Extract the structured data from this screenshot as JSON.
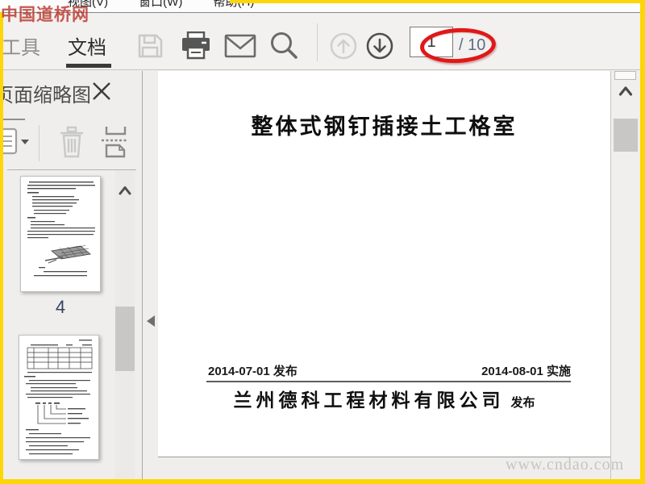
{
  "stamp_watermark": "中国道桥网",
  "site_watermark": "www.cndao.com",
  "menu_bar": {
    "items": [
      {
        "label": "视图(V)"
      },
      {
        "label": "窗口(W)"
      },
      {
        "label": "帮助(H)"
      }
    ]
  },
  "toolbar": {
    "tools_tab": "工具",
    "document_tab": "文档",
    "page_input": {
      "value": "1"
    },
    "page_total": "/ 10"
  },
  "sidebar": {
    "title": "页面缩略图",
    "thumbnails": [
      {
        "page_number": "4"
      },
      {
        "page_number": ""
      }
    ]
  },
  "page": {
    "title": "整体式钢钉插接土工格室",
    "release_date": "2014-07-01 发布",
    "implement_date": "2014-08-01 实施",
    "company": "兰州德科工程材料有限公司",
    "company_action": "发布"
  },
  "colors": {
    "frame_accent": "#fdd605",
    "annotation_red": "#e01818",
    "active_tab": "#2d2d2d"
  }
}
